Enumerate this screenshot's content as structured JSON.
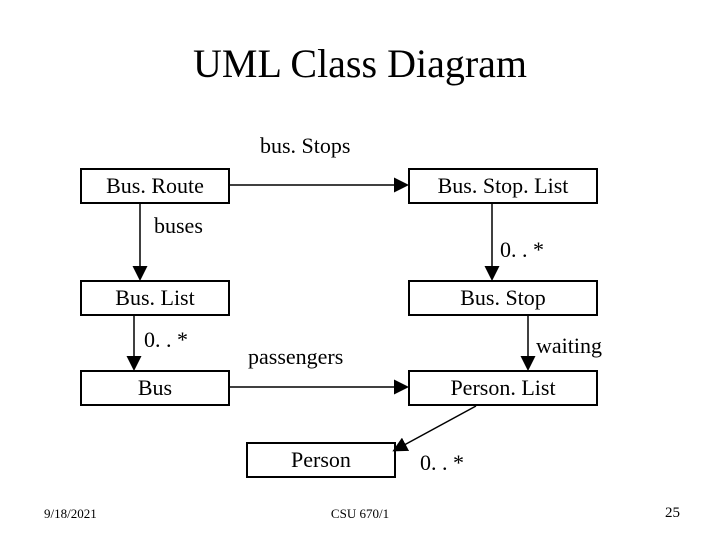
{
  "title": "UML Class Diagram",
  "classes": {
    "busRoute": "Bus. Route",
    "busStopList": "Bus. Stop. List",
    "busList": "Bus. List",
    "busStop": "Bus. Stop",
    "bus": "Bus",
    "personList": "Person. List",
    "person": "Person"
  },
  "labels": {
    "busStops": "bus. Stops",
    "buses": "buses",
    "mult_bslist_bs": "0. . *",
    "mult_bl_bus": "0. . *",
    "passengers": "passengers",
    "waiting": "waiting",
    "mult_pl_person": "0. . *"
  },
  "footer": {
    "date": "9/18/2021",
    "course": "CSU 670/1",
    "page": "25"
  }
}
